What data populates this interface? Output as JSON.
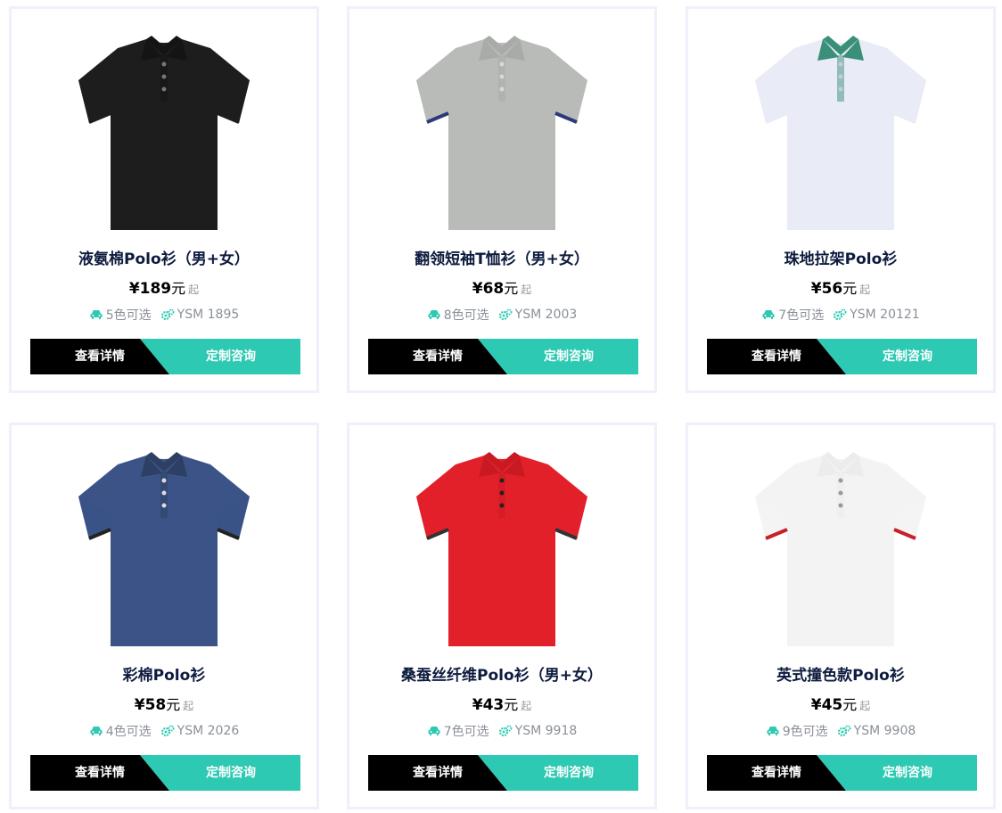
{
  "labels": {
    "detail": "查看详情",
    "consult": "定制咨询",
    "qi": "起"
  },
  "colors": {
    "accent": "#2ec9b3",
    "dark": "#000000",
    "title": "#0d1b3e",
    "border": "#eef0fb"
  },
  "products": [
    {
      "name": "液氨棉Polo衫（男+女）",
      "price": "¥189",
      "unit": "元",
      "colors_text": "5色可选",
      "sku": "YSM 1895",
      "shirt": {
        "body": "#1d1d1d",
        "collar": "#141414",
        "trim": "#1d1d1d",
        "button": "#777777"
      }
    },
    {
      "name": "翻领短袖T恤衫（男+女）",
      "price": "¥68",
      "unit": "元",
      "colors_text": "8色可选",
      "sku": "YSM 2003",
      "shirt": {
        "body": "#b9bbb8",
        "collar": "#a9aba8",
        "trim": "#2d3a7a",
        "button": "#d8d8d8"
      }
    },
    {
      "name": "珠地拉架Polo衫",
      "price": "¥56",
      "unit": "元",
      "colors_text": "7色可选",
      "sku": "YSM 20121",
      "shirt": {
        "body": "#e9ebf6",
        "collar": "#3a8f78",
        "trim": "#e9ebf6",
        "button": "#c9cbd6"
      }
    },
    {
      "name": "彩棉Polo衫",
      "price": "¥58",
      "unit": "元",
      "colors_text": "4色可选",
      "sku": "YSM 2026",
      "shirt": {
        "body": "#3b5386",
        "collar": "#2e3f64",
        "trim": "#222222",
        "button": "#dcdcdc"
      }
    },
    {
      "name": "桑蚕丝纤维Polo衫（男+女）",
      "price": "¥43",
      "unit": "元",
      "colors_text": "7色可选",
      "sku": "YSM 9918",
      "shirt": {
        "body": "#e2202a",
        "collar": "#c91a23",
        "trim": "#333333",
        "button": "#222222"
      }
    },
    {
      "name": "英式撞色款Polo衫",
      "price": "¥45",
      "unit": "元",
      "colors_text": "9色可选",
      "sku": "YSM 9908",
      "shirt": {
        "body": "#f3f3f3",
        "collar": "#ececec",
        "trim": "#c8202a",
        "button": "#999999"
      }
    }
  ]
}
